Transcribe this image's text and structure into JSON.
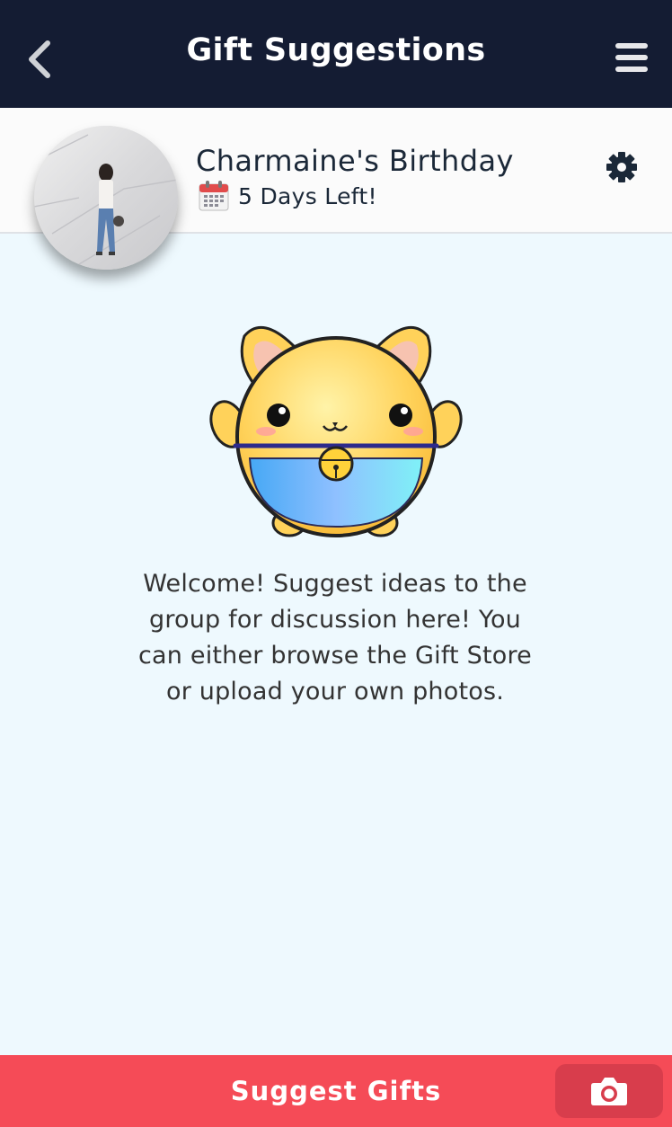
{
  "header": {
    "title": "Gift Suggestions",
    "back_icon": "chevron-left-icon",
    "menu_icon": "hamburger-menu-icon"
  },
  "event": {
    "name": "Charmaine's Birthday",
    "countdown": "5 Days Left!",
    "calendar_icon": "calendar-icon",
    "settings_icon": "gear-icon"
  },
  "main": {
    "welcome_text": "Welcome! Suggest ideas to the group for discussion here! You can either browse the Gift Store or upload your own photos.",
    "mascot_icon": "cat-mascot-icon"
  },
  "footer": {
    "suggest_label": "Suggest Gifts",
    "camera_icon": "camera-icon"
  },
  "colors": {
    "topbar": "#141c33",
    "background": "#eef9fe",
    "accent": "#f54b57",
    "camera_button": "#d83d4c",
    "text_dark": "#1b2838"
  }
}
